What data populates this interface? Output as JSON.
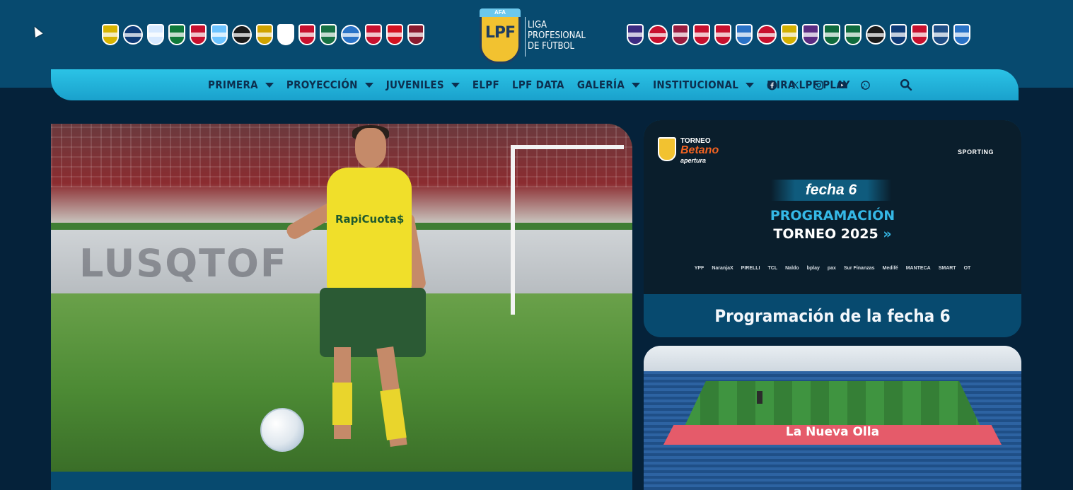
{
  "header": {
    "logo": {
      "afa": "AFA",
      "mark": "LPF",
      "text": "LIGA\nPROFESIONAL\nDE FÚTBOL"
    },
    "crests_left_count": 15,
    "crests_right_count": 16
  },
  "nav": {
    "items": [
      {
        "label": "PRIMERA",
        "has_dropdown": true
      },
      {
        "label": "PROYECCIÓN",
        "has_dropdown": true
      },
      {
        "label": "JUVENILES",
        "has_dropdown": true
      },
      {
        "label": "ELPF",
        "has_dropdown": false
      },
      {
        "label": "LPF DATA",
        "has_dropdown": false
      },
      {
        "label": "GALERÍA",
        "has_dropdown": true
      },
      {
        "label": "INSTITUCIONAL",
        "has_dropdown": true
      },
      {
        "label": "MIRA LPF PLAY",
        "has_dropdown": false
      }
    ],
    "socials": [
      "facebook-icon",
      "x-icon",
      "instagram-icon",
      "youtube-icon",
      "whatsapp-icon"
    ],
    "search_icon": "search-icon"
  },
  "hero": {
    "ad_text": "LUSQTOF",
    "shirt_text": "RapiCuota$"
  },
  "cards": {
    "card1": {
      "torneo": "TORNEO",
      "brand": "Betano",
      "phase": "apertura",
      "sponsor": "SPORTING",
      "fecha": "fecha 6",
      "prog_line1": "PROGRAMACIÓN",
      "prog_line2": "TORNEO 2025",
      "sponsors": [
        "YPF",
        "NaranjaX",
        "PIRELLI",
        "TCL",
        "Naldo",
        "bplay",
        "pax",
        "Sur Finanzas",
        "Medifé",
        "MANTECA",
        "SMART",
        "OT"
      ],
      "title": "Programación de la fecha 6"
    },
    "card2": {
      "stadium_name": "La Nueva Olla"
    }
  }
}
